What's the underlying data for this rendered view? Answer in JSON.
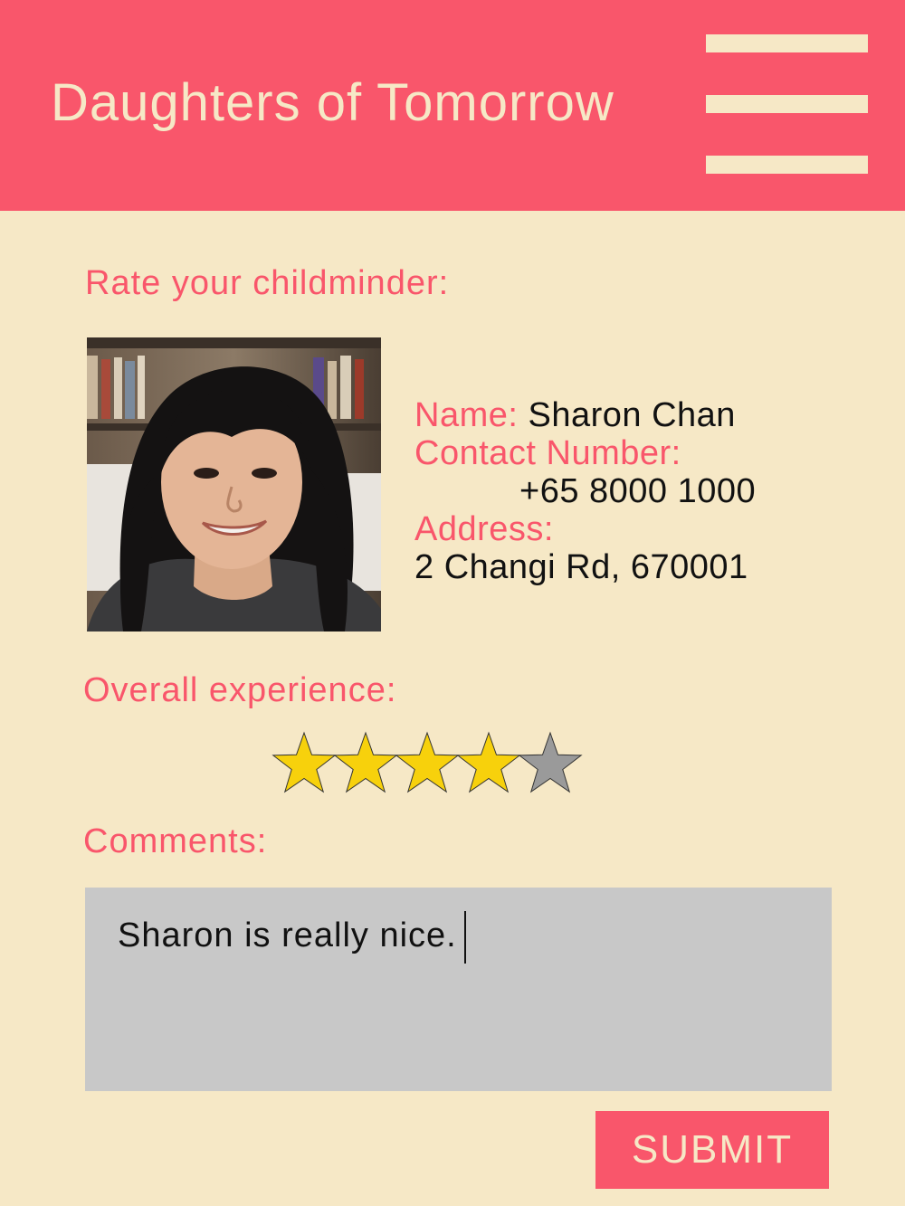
{
  "header": {
    "title": "Daughters of Tomorrow",
    "menu_icon": "hamburger-menu-icon"
  },
  "rate_heading": "Rate your childminder:",
  "childminder": {
    "name_label": "Name:",
    "name": "Sharon Chan",
    "contact_label": "Contact Number:",
    "contact_number": "+65 8000 1000",
    "address_label": "Address:",
    "address": "2 Changi Rd, 670001"
  },
  "experience": {
    "label": "Overall experience:",
    "rating": 4,
    "max_rating": 5,
    "filled_color": "#f7d10c",
    "empty_color": "#9a9a9a"
  },
  "comments": {
    "label": "Comments:",
    "value": "Sharon is really nice."
  },
  "submit_label": "SUBMIT",
  "colors": {
    "accent": "#f9566b",
    "background": "#f6e8c6",
    "comment_box": "#c8c8c8"
  }
}
